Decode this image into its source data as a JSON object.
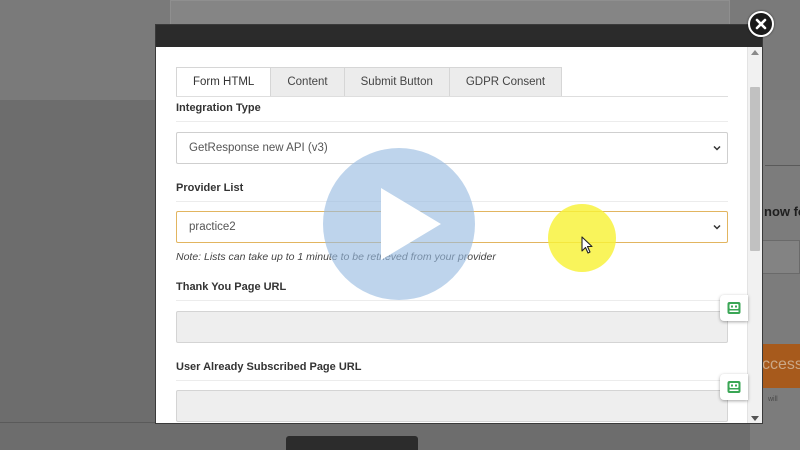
{
  "background": {
    "right_heading": "now fo",
    "orange_button": "ccess",
    "small_text": "will"
  },
  "modal": {
    "tabs": [
      {
        "label": "Form HTML",
        "active": true
      },
      {
        "label": "Content",
        "active": false
      },
      {
        "label": "Submit Button",
        "active": false
      },
      {
        "label": "GDPR Consent",
        "active": false
      }
    ],
    "integration_type": {
      "label": "Integration Type",
      "value": "GetResponse new API (v3)"
    },
    "provider_list": {
      "label": "Provider List",
      "value": "practice2",
      "note": "Note: Lists can take up to 1 minute to be retrieved from your provider"
    },
    "thank_you_url": {
      "label": "Thank You Page URL",
      "value": ""
    },
    "already_subscribed_url": {
      "label": "User Already Subscribed Page URL",
      "value": ""
    }
  },
  "icons": {
    "close": "close-icon",
    "play": "play-icon",
    "chevron": "chevron-down-icon",
    "badge": "chat-bot-icon",
    "cursor": "mouse-cursor-icon"
  },
  "colors": {
    "focused_border": "#e2b560",
    "badge_green": "#3aa655",
    "play_overlay": "#96b9e1",
    "cursor_halo": "#f8f237"
  }
}
